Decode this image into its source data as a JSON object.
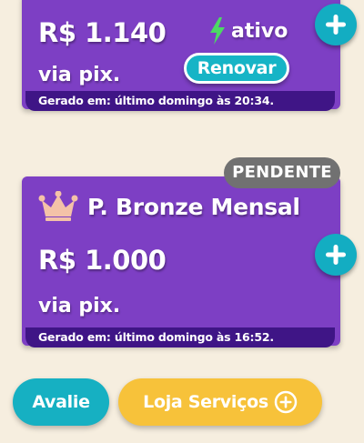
{
  "cards": [
    {
      "price": "R$ 1.140",
      "payment_method": "via pix.",
      "status_label": "ativo",
      "renew_label": "Renovar",
      "generated_at": "Gerado em: último domingo às 20:34."
    },
    {
      "badge": "PENDENTE",
      "plan_name": "P. Bronze Mensal",
      "price": "R$ 1.000",
      "payment_method": "via pix.",
      "generated_at": "Gerado em: último domingo às 16:52."
    }
  ],
  "footer": {
    "rate_label": "Avalie",
    "shop_label": "Loja Serviços"
  },
  "icons": {
    "status": "lightning-bolt-icon",
    "add": "plus-icon",
    "plan": "crown-icon",
    "shop": "circle-plus-icon"
  },
  "colors": {
    "card_purple": "#7d3fc4",
    "bar_dark_purple": "#3f1586",
    "teal": "#16b0c2",
    "bolt_green": "#4cd964",
    "badge_gray": "#717171",
    "shop_yellow": "#f7c23a",
    "crown_peach": "#f4c2a8",
    "background": "#f6eedf"
  }
}
